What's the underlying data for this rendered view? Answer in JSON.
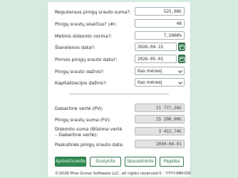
{
  "form": {
    "payment": {
      "label": "Reguliaraus pinigų srauto suma?:",
      "value": "525,00€"
    },
    "count": {
      "label": "Pinigų srautų skaičius? (#):",
      "value": "48"
    },
    "rate": {
      "label": "Metinis diskonto norma?:",
      "value": "7,5000%"
    },
    "today": {
      "label": "Šiandienos data?:",
      "value": "2026-04-15"
    },
    "first": {
      "label": "Pirmos pinigų srauto data?:",
      "value": "2026-05-01"
    },
    "frequency": {
      "label": "Pinigų srauto dažnis?:",
      "value": "Kas mėnesį"
    },
    "compounding": {
      "label": "Kapitalizacijos dažnis?:",
      "value": "Kas mėnesį"
    }
  },
  "results": {
    "pv": {
      "label": "Dabartinė vertė (PV):",
      "value": "21 777,26€"
    },
    "fv": {
      "label": "Pinigų srautų suma (FV):",
      "value": "25 200,00€"
    },
    "discount": {
      "label": "Diskonto suma (Būsima vertė – Dabartinė vertė):",
      "value": "3 422,74€"
    },
    "last": {
      "label": "Paskutinės pinigų srauto data:",
      "value": "2030-04-01"
    }
  },
  "buttons": {
    "calculate": "Apskaičiuokite",
    "clear": "Išvalykite",
    "print": "Spausdinkite",
    "help": "Pagalba"
  },
  "footer": "©2026 Pine Grove Software LLC, all rights reserved  € : YYYY-MM-DD",
  "icons": {
    "calendar": "calendar-icon",
    "dropdown": "chevron-down-icon"
  },
  "colors": {
    "accent": "#2c8a4e",
    "background": "#d6ebdf"
  }
}
